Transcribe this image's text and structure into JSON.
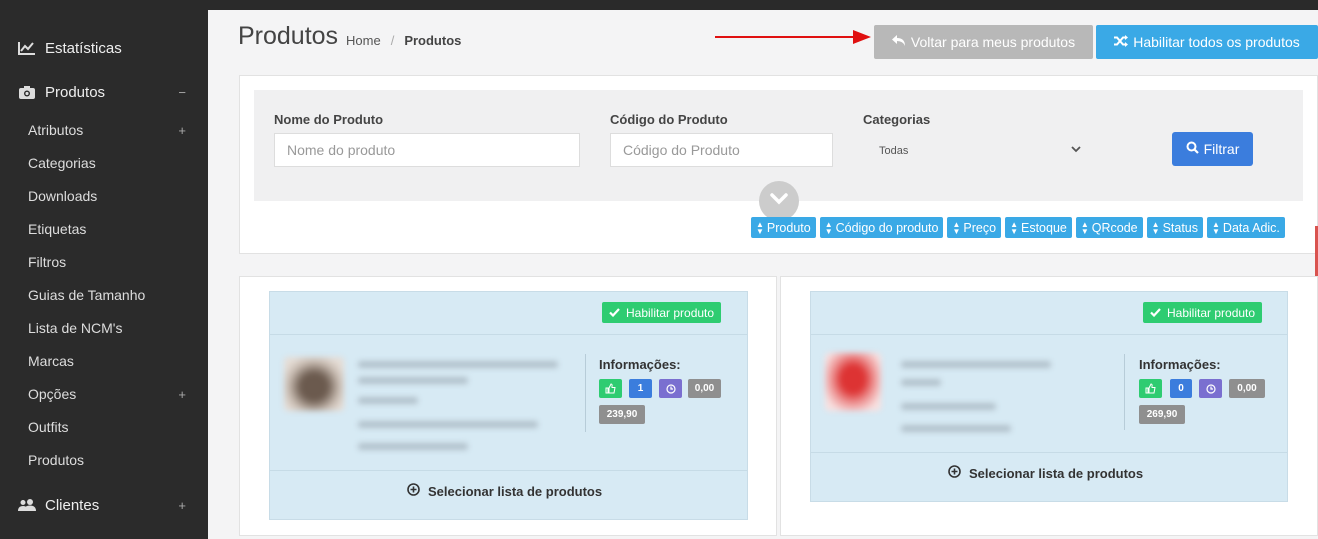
{
  "sidebar": {
    "sections": [
      {
        "label": "Estatísticas",
        "icon": "chart-line-icon"
      },
      {
        "label": "Produtos",
        "icon": "camera-icon",
        "toggle": "−"
      },
      {
        "label": "Clientes",
        "icon": "users-icon",
        "toggle": "+"
      }
    ],
    "items": [
      {
        "label": "Atributos",
        "toggle": "+"
      },
      {
        "label": "Categorias"
      },
      {
        "label": "Downloads"
      },
      {
        "label": "Etiquetas"
      },
      {
        "label": "Filtros"
      },
      {
        "label": "Guias de Tamanho"
      },
      {
        "label": "Lista de NCM's"
      },
      {
        "label": "Marcas"
      },
      {
        "label": "Opções",
        "toggle": "+"
      },
      {
        "label": "Outfits"
      },
      {
        "label": "Produtos"
      }
    ]
  },
  "header": {
    "title": "Produtos",
    "breadcrumb": {
      "home": "Home",
      "sep": "/",
      "current": "Produtos"
    },
    "back_button": "Voltar para meus produtos",
    "enable_all_button": "Habilitar todos os produtos"
  },
  "filters": {
    "name_label": "Nome do Produto",
    "name_placeholder": "Nome do produto",
    "code_label": "Código do Produto",
    "code_placeholder": "Código do Produto",
    "category_label": "Categorias",
    "category_value": "Todas",
    "filter_button": "Filtrar"
  },
  "sort_buttons": [
    "Produto",
    "Código do produto",
    "Preço",
    "Estoque",
    "QRcode",
    "Status",
    "Data Adic."
  ],
  "products": [
    {
      "enable_label": "Habilitar produto",
      "info_title": "Informações:",
      "pills": {
        "a": "",
        "b": "1",
        "c": "",
        "d": "0,00",
        "price": "239,90"
      },
      "select_label": "Selecionar lista de produtos"
    },
    {
      "enable_label": "Habilitar produto",
      "info_title": "Informações:",
      "pills": {
        "a": "",
        "b": "0",
        "c": "",
        "d": "0,00",
        "price": "269,90"
      },
      "select_label": "Selecionar lista de produtos"
    }
  ],
  "colors": {
    "sidebar_bg": "#2b2b2b",
    "accent_blue": "#3aa9e6",
    "filter_blue": "#3b7ddd",
    "success_green": "#2ecc71",
    "muted_gray": "#b8b8b8"
  }
}
